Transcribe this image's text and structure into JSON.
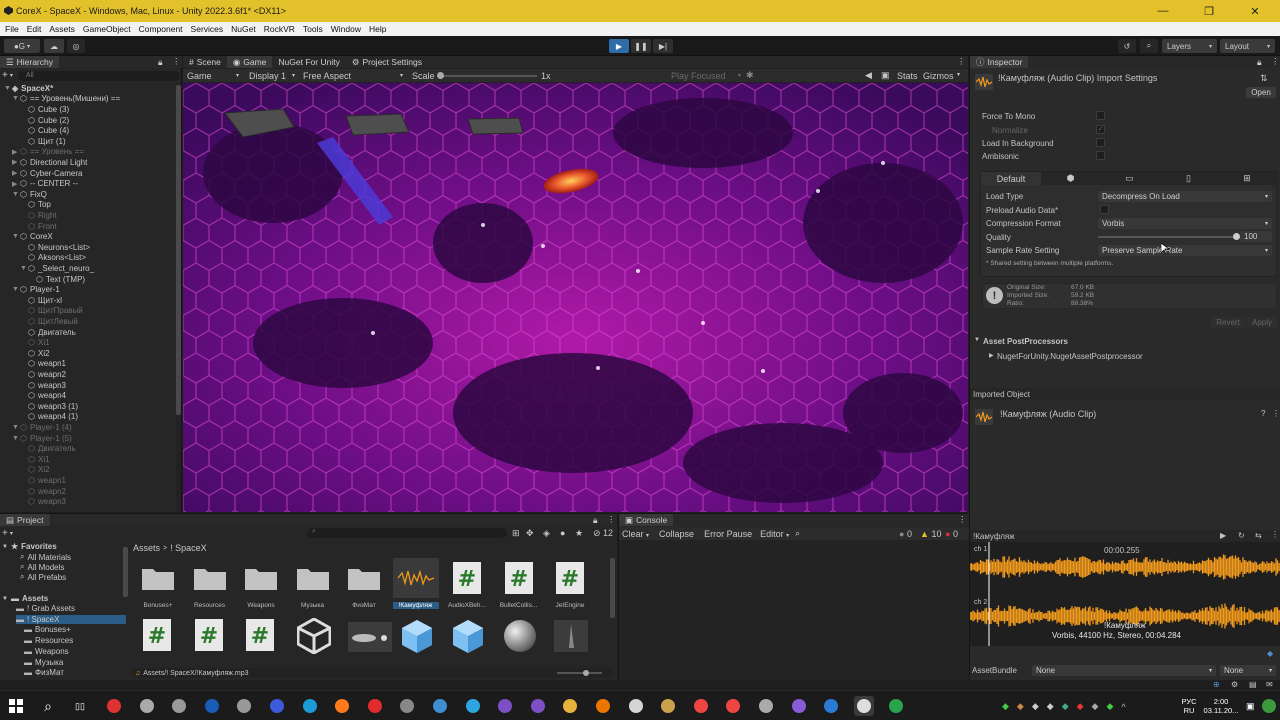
{
  "window": {
    "title": "CoreX - SpaceX - Windows, Mac, Linux - Unity 2022.3.6f1* <DX11>",
    "controls": [
      "—",
      "❐",
      "✕"
    ]
  },
  "menu": [
    "File",
    "Edit",
    "Assets",
    "GameObject",
    "Component",
    "Services",
    "NuGet",
    "RockVR",
    "Tools",
    "Window",
    "Help"
  ],
  "toolbar": {
    "account": "G",
    "layers": "Layers",
    "layout": "Layout"
  },
  "hierarchy": {
    "tab": "Hierarchy",
    "search": "All",
    "items": [
      {
        "label": "SpaceX*",
        "depth": 0,
        "style": "scene"
      },
      {
        "label": "== Уровень(Мишени) ==",
        "depth": 1,
        "style": "normal"
      },
      {
        "label": "Cube (3)",
        "depth": 2,
        "style": "normal"
      },
      {
        "label": "Cube (2)",
        "depth": 2,
        "style": "normal"
      },
      {
        "label": "Cube (4)",
        "depth": 2,
        "style": "normal"
      },
      {
        "label": "Щит (1)",
        "depth": 2,
        "style": "normal"
      },
      {
        "label": "== Уровень ==",
        "depth": 1,
        "style": "dim"
      },
      {
        "label": "Directional Light",
        "depth": 1,
        "style": "normal"
      },
      {
        "label": "Cyber-Camera",
        "depth": 1,
        "style": "normal"
      },
      {
        "label": "-- CENTER --",
        "depth": 1,
        "style": "normal"
      },
      {
        "label": "FixQ",
        "depth": 1,
        "style": "normal"
      },
      {
        "label": "Top",
        "depth": 2,
        "style": "normal"
      },
      {
        "label": "Right",
        "depth": 2,
        "style": "dim"
      },
      {
        "label": "Front",
        "depth": 2,
        "style": "dim"
      },
      {
        "label": "CoreX",
        "depth": 1,
        "style": "normal"
      },
      {
        "label": "Neurons<List>",
        "depth": 2,
        "style": "normal"
      },
      {
        "label": "Aksons<List>",
        "depth": 2,
        "style": "normal"
      },
      {
        "label": "_Select_neuro_",
        "depth": 2,
        "style": "normal"
      },
      {
        "label": "Text (TMP)",
        "depth": 3,
        "style": "normal"
      },
      {
        "label": "Player-1",
        "depth": 1,
        "style": "normal"
      },
      {
        "label": "Щит-xl",
        "depth": 2,
        "style": "normal"
      },
      {
        "label": "ЩитПравый",
        "depth": 2,
        "style": "dim"
      },
      {
        "label": "ЩитЛевый",
        "depth": 2,
        "style": "dim"
      },
      {
        "label": "Двигатель",
        "depth": 2,
        "style": "normal"
      },
      {
        "label": "Xi1",
        "depth": 2,
        "style": "dim"
      },
      {
        "label": "Xi2",
        "depth": 2,
        "style": "normal"
      },
      {
        "label": "weapn1",
        "depth": 2,
        "style": "normal"
      },
      {
        "label": "weapn2",
        "depth": 2,
        "style": "normal"
      },
      {
        "label": "weapn3",
        "depth": 2,
        "style": "normal"
      },
      {
        "label": "weapn4",
        "depth": 2,
        "style": "normal"
      },
      {
        "label": "weapn3 (1)",
        "depth": 2,
        "style": "normal"
      },
      {
        "label": "weapn4 (1)",
        "depth": 2,
        "style": "normal"
      },
      {
        "label": "Player-1 (4)",
        "depth": 1,
        "style": "dim"
      },
      {
        "label": "Player-1 (5)",
        "depth": 1,
        "style": "dim"
      },
      {
        "label": "Двигатель",
        "depth": 2,
        "style": "dim"
      },
      {
        "label": "Xi1",
        "depth": 2,
        "style": "dim"
      },
      {
        "label": "Xi2",
        "depth": 2,
        "style": "dim"
      },
      {
        "label": "weapn1",
        "depth": 2,
        "style": "dim"
      },
      {
        "label": "weapn2",
        "depth": 2,
        "style": "dim"
      },
      {
        "label": "weapn3",
        "depth": 2,
        "style": "dim"
      }
    ]
  },
  "center_tabs": {
    "scene": "Scene",
    "game": "Game",
    "nuget": "NuGet For Unity",
    "project_settings": "Project Settings"
  },
  "game_bar": {
    "mode": "Game",
    "display": "Display 1",
    "aspect": "Free Aspect",
    "scale_label": "Scale",
    "scale_value": "1x",
    "play_focused": "Play Focused",
    "stats": "Stats",
    "gizmos": "Gizmos"
  },
  "inspector": {
    "tab": "Inspector",
    "header": "!Камуфляж (Audio Clip) Import Settings",
    "open": "Open",
    "fields": {
      "force_to_mono": "Force To Mono",
      "normalize": "Normalize",
      "load_in_background": "Load In Background",
      "ambisonic": "Ambisonic"
    },
    "platform_tab": "Default",
    "load_type_label": "Load Type",
    "load_type_value": "Decompress On Load",
    "preload_label": "Preload Audio Data*",
    "compression_label": "Compression Format",
    "compression_value": "Vorbis",
    "quality_label": "Quality",
    "quality_value": "100",
    "quality_fraction": 1.0,
    "sample_rate_label": "Sample Rate Setting",
    "sample_rate_value": "Preserve Sample Rate",
    "shared_note": "* Shared setting between multiple platforms.",
    "original_size": "Original Size:",
    "original_size_value": "67.0 KB",
    "imported_size": "Imported Size:",
    "imported_size_value": "59.2 KB",
    "ratio": "Ratio:",
    "ratio_value": "88.38%",
    "revert": "Revert",
    "apply": "Apply",
    "asset_postprocessors": "Asset PostProcessors",
    "postprocessor_item": "NugetForUnity.NugetAssetPostprocessor",
    "imported_object": "Imported Object",
    "imported_clip": "!Камуфляж (Audio Clip)",
    "preview_title": "!Камуфляж",
    "preview_time": "00:00.255",
    "ch1": "ch 1",
    "ch2": "ch 2",
    "preview_name": "!Камуфляж",
    "preview_info": "Vorbis, 44100 Hz, Stereo, 00:04.284",
    "assetbundle_label": "AssetBundle",
    "assetbundle_value": "None",
    "assetbundle_variant": "None"
  },
  "project": {
    "tab": "Project",
    "breadcrumb": "Assets > ! SpaceX",
    "crumb_assets": "Assets",
    "crumb_current": "! SpaceX",
    "hidden_count": "12",
    "favorites": "Favorites",
    "favorites_items": [
      "All Materials",
      "All Models",
      "All Prefabs"
    ],
    "assets_root": "Assets",
    "assets_tree": [
      {
        "label": "! Grab Assets",
        "depth": 1
      },
      {
        "label": "! SpaceX",
        "depth": 1
      },
      {
        "label": "Bonuses+",
        "depth": 2
      },
      {
        "label": "Resources",
        "depth": 2
      },
      {
        "label": "Weapons",
        "depth": 2
      },
      {
        "label": "Музыка",
        "depth": 2
      },
      {
        "label": "ФизМат",
        "depth": 2
      }
    ],
    "grid_row1": [
      "Bonuses+",
      "Resources",
      "Weapons",
      "Музыка",
      "ФизМат",
      "!Камуфляж",
      "AudioXBeh...",
      "BulletCollis...",
      "JetEngine"
    ],
    "path": "Assets/! SpaceX/!Камуфляж.mp3"
  },
  "console": {
    "tab": "Console",
    "clear": "Clear",
    "collapse": "Collapse",
    "error_pause": "Error Pause",
    "editor": "Editor",
    "count_msg": "0",
    "count_warn": "10",
    "count_err": "0"
  },
  "taskbar": {
    "lang_top": "РУС",
    "lang_bottom": "RU",
    "time": "2:00",
    "date": "03.11.20..."
  },
  "colors": {
    "title_bar": "#e2c12b",
    "accent": "#2e6ca8",
    "waveform": "#f19a1b"
  }
}
